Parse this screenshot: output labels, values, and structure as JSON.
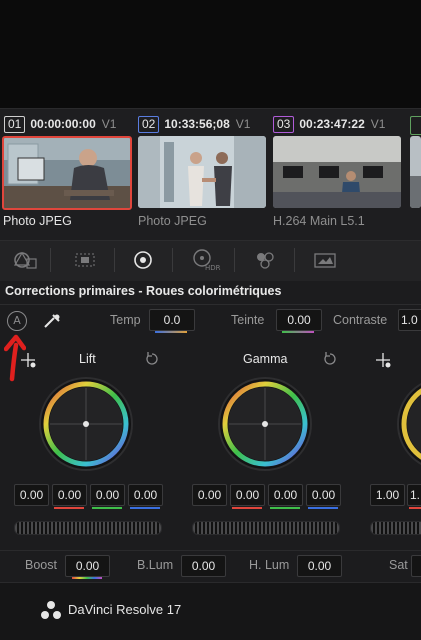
{
  "clips": [
    {
      "number": "01",
      "timecode": "00:00:00:00",
      "track": "V1",
      "codec": "Photo JPEG",
      "selected": true
    },
    {
      "number": "02",
      "timecode": "10:33:56;08",
      "track": "V1",
      "codec": "Photo JPEG",
      "selected": false
    },
    {
      "number": "03",
      "timecode": "00:23:47:22",
      "track": "V1",
      "codec": "H.264 Main L5.1",
      "selected": false
    }
  ],
  "clip_number_colors": [
    "#d8d8d8",
    "#5a7de0",
    "#b05cd8"
  ],
  "toolbar_icons": [
    "camera-raw-icon",
    "color-match-icon",
    "color-wheels-icon",
    "hdr-wheels-icon",
    "rgb-mixer-icon",
    "motion-effects-icon"
  ],
  "toolbar": {
    "hdr_label": "HDR"
  },
  "panel": {
    "title": "Corrections primaires - Roues colorimétriques",
    "auto_label": "A",
    "temp_label": "Temp",
    "temp_value": "0.0",
    "tint_label": "Teinte",
    "tint_value": "0.00",
    "contrast_label": "Contraste",
    "contrast_value": "1.0"
  },
  "wheels": {
    "lift": {
      "title": "Lift",
      "values": [
        "0.00",
        "0.00",
        "0.00",
        "0.00"
      ]
    },
    "gamma": {
      "title": "Gamma",
      "values": [
        "0.00",
        "0.00",
        "0.00",
        "0.00"
      ]
    },
    "gain": {
      "values": [
        "1.00",
        "1."
      ]
    }
  },
  "bottom": {
    "boost_label": "Boost",
    "boost_value": "0.00",
    "blum_label": "B.Lum",
    "blum_value": "0.00",
    "hlum_label": "H. Lum",
    "hlum_value": "0.00",
    "sat_label": "Sat"
  },
  "footer": {
    "app_name": "DaVinci Resolve 17"
  },
  "colors": {
    "selection": "#e0463c",
    "annotation_arrow": "#e0201e",
    "accent_red": "#e0463c",
    "accent_green": "#3fbf4a",
    "accent_blue": "#3a6fe0"
  }
}
